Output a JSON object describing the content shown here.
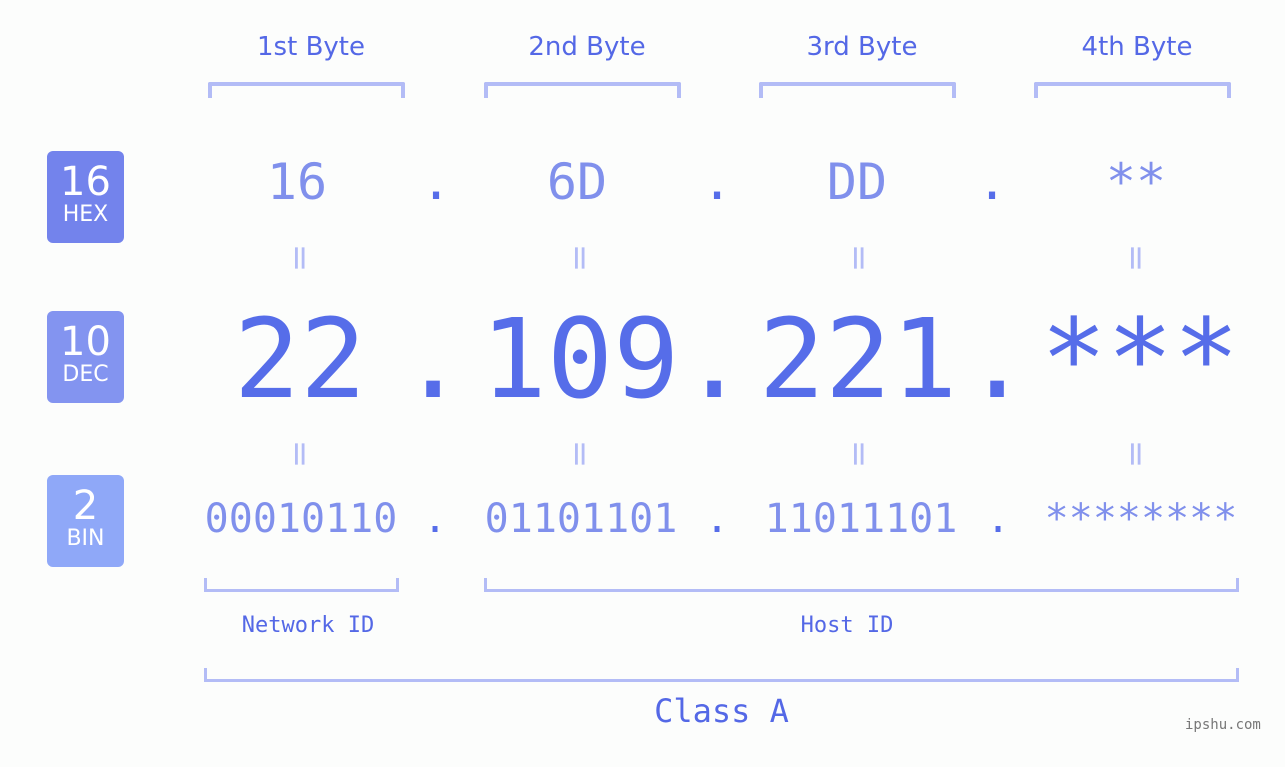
{
  "byte_headers": [
    "1st Byte",
    "2nd Byte",
    "3rd Byte",
    "4th Byte"
  ],
  "badges": [
    {
      "number": "16",
      "base": "HEX",
      "color": "#7383ec"
    },
    {
      "number": "10",
      "base": "DEC",
      "color": "#8394f0"
    },
    {
      "number": "2",
      "base": "BIN",
      "color": "#8fa8f8"
    }
  ],
  "hex": [
    "16",
    "6D",
    "DD",
    "**"
  ],
  "dec": [
    "22",
    "109",
    "221",
    "***"
  ],
  "bin": [
    "00010110",
    "01101101",
    "11011101",
    "********"
  ],
  "separator": ".",
  "equals": "=",
  "network_label": "Network ID",
  "host_label": "Host ID",
  "class_label": "Class A",
  "watermark": "ipshu.com",
  "colors": {
    "accent": "#566de9",
    "light": "#8090ec",
    "bracket": "#b3bcf6",
    "background": "#fcfdfc"
  }
}
